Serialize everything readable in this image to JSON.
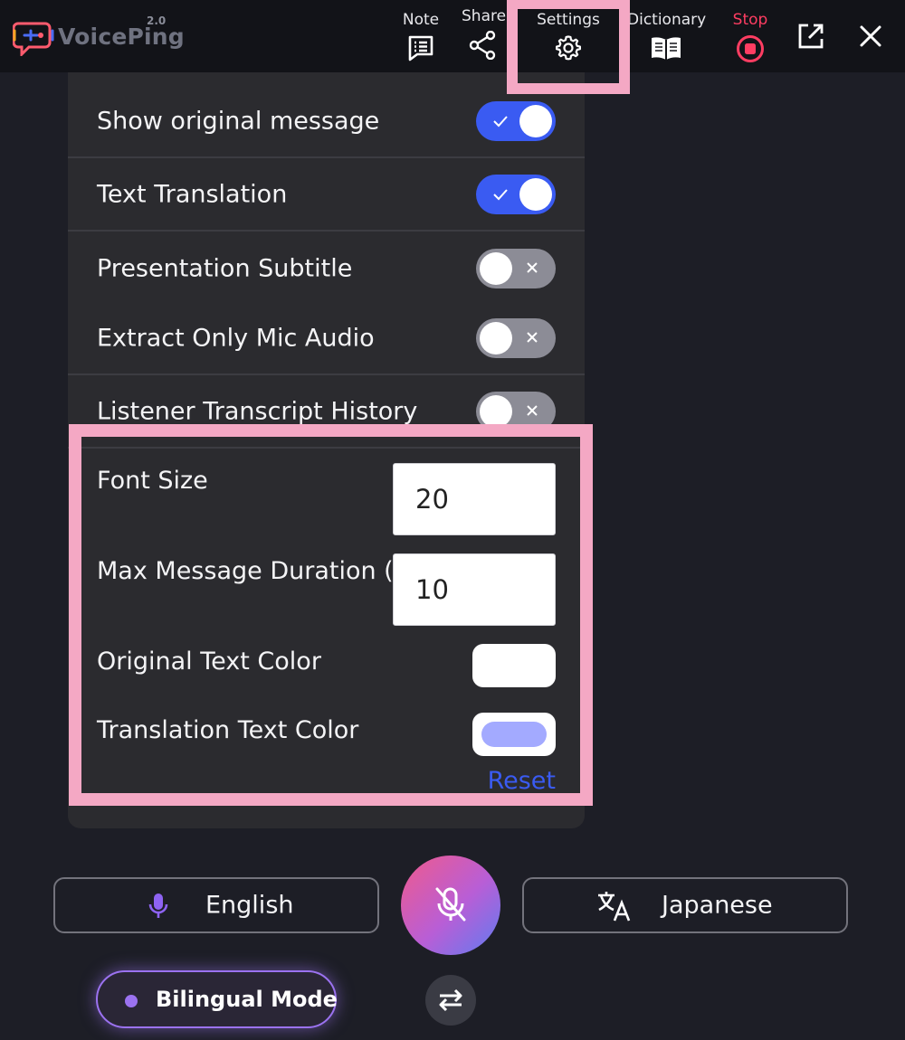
{
  "app": {
    "logo_text": "VoicePing",
    "logo_version": "2.0"
  },
  "nav": {
    "note": "Note",
    "share": "Share",
    "settings": "Settings",
    "dictionary": "Dictionary",
    "stop": "Stop"
  },
  "settings": {
    "toggles": [
      {
        "label": "Show original message",
        "state": "on"
      },
      {
        "label": "Text Translation",
        "state": "on"
      },
      {
        "label": "Presentation Subtitle",
        "state": "off"
      },
      {
        "label": "Extract Only Mic Audio",
        "state": "off"
      },
      {
        "label": "Listener Transcript History",
        "state": "off"
      }
    ],
    "font_size_label": "Font Size",
    "font_size_value": "20",
    "max_duration_label": "Max Message Duration (s)",
    "max_duration_value": "10",
    "original_color_label": "Original Text Color",
    "original_color": "#ffffff",
    "translation_color_label": "Translation Text Color",
    "translation_color": "#a3aaff",
    "reset_label": "Reset"
  },
  "controls": {
    "source_language": "English",
    "target_language": "Japanese",
    "mode_label": "Bilingual Mode"
  },
  "colors": {
    "accent_blue": "#3a5bf2",
    "stop_red": "#ff3d62",
    "highlight_pink": "#f4a8c4",
    "mode_purple": "#9b72f0"
  }
}
